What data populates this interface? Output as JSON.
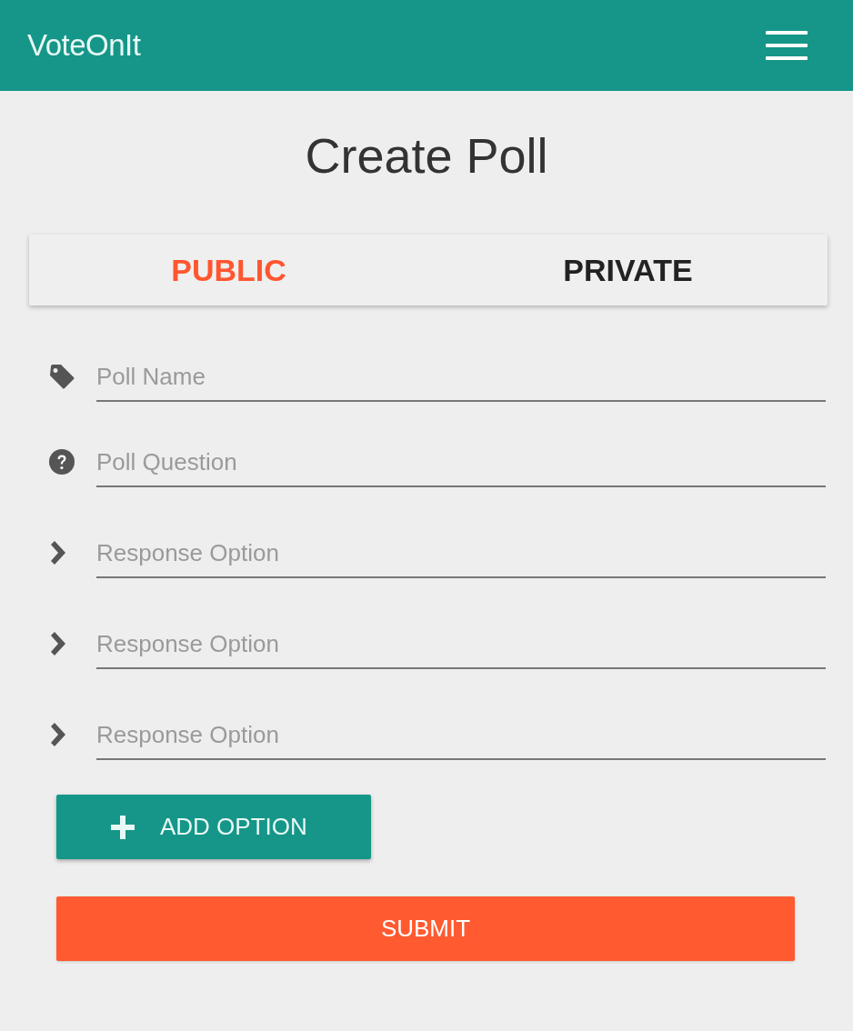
{
  "app_bar": {
    "title": "VoteOnIt"
  },
  "heading": "Create Poll",
  "tabs": [
    {
      "label": "PUBLIC",
      "selected": true
    },
    {
      "label": "PRIVATE",
      "selected": false
    }
  ],
  "fields": [
    {
      "kind": "tag",
      "placeholder": "Poll Name"
    },
    {
      "kind": "question",
      "placeholder": "Poll Question"
    },
    {
      "kind": "option",
      "placeholder": "Response Option"
    },
    {
      "kind": "option",
      "placeholder": "Response Option"
    },
    {
      "kind": "option",
      "placeholder": "Response Option"
    }
  ],
  "add_button": {
    "label": "ADD OPTION"
  },
  "submit_button": {
    "label": "SUBMIT"
  }
}
